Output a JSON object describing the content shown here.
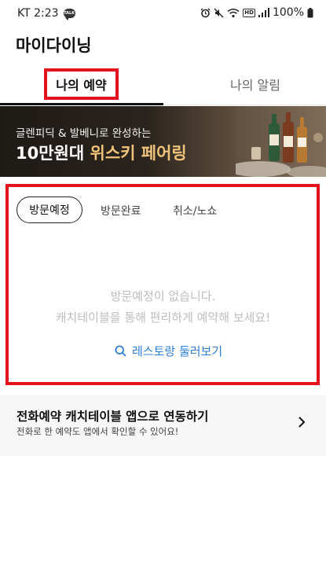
{
  "status_bar": {
    "carrier_time": "KT 2:23",
    "talk_badge": "TALK",
    "hd_label": "HD",
    "battery": "100%"
  },
  "header": {
    "title": "마이다이닝"
  },
  "tabs": [
    {
      "label": "나의 예약",
      "active": true
    },
    {
      "label": "나의 알림",
      "active": false
    }
  ],
  "banner": {
    "subtitle": "글렌피딕 & 발베니로 완성하는",
    "headline_prefix": "10만원대 ",
    "headline_accent": "위스키 페어링"
  },
  "sub_tabs": [
    {
      "label": "방문예정",
      "selected": true
    },
    {
      "label": "방문완료",
      "selected": false
    },
    {
      "label": "취소/노쇼",
      "selected": false
    }
  ],
  "empty_state": {
    "line1": "방문예정이 없습니다.",
    "line2": "캐치테이블을 통해 편리하게 예약해 보세요!",
    "action_label": "레스토랑 둘러보기"
  },
  "app_link": {
    "title": "전화예약 캐치테이블 앱으로 연동하기",
    "subtitle": "전화로 한 예약도 앱에서 확인할 수 있어요!"
  },
  "colors": {
    "highlight_red": "#e4121c",
    "link_blue": "#2e7fd6",
    "banner_accent": "#f0c37a",
    "muted_text": "#bdbdbd"
  }
}
